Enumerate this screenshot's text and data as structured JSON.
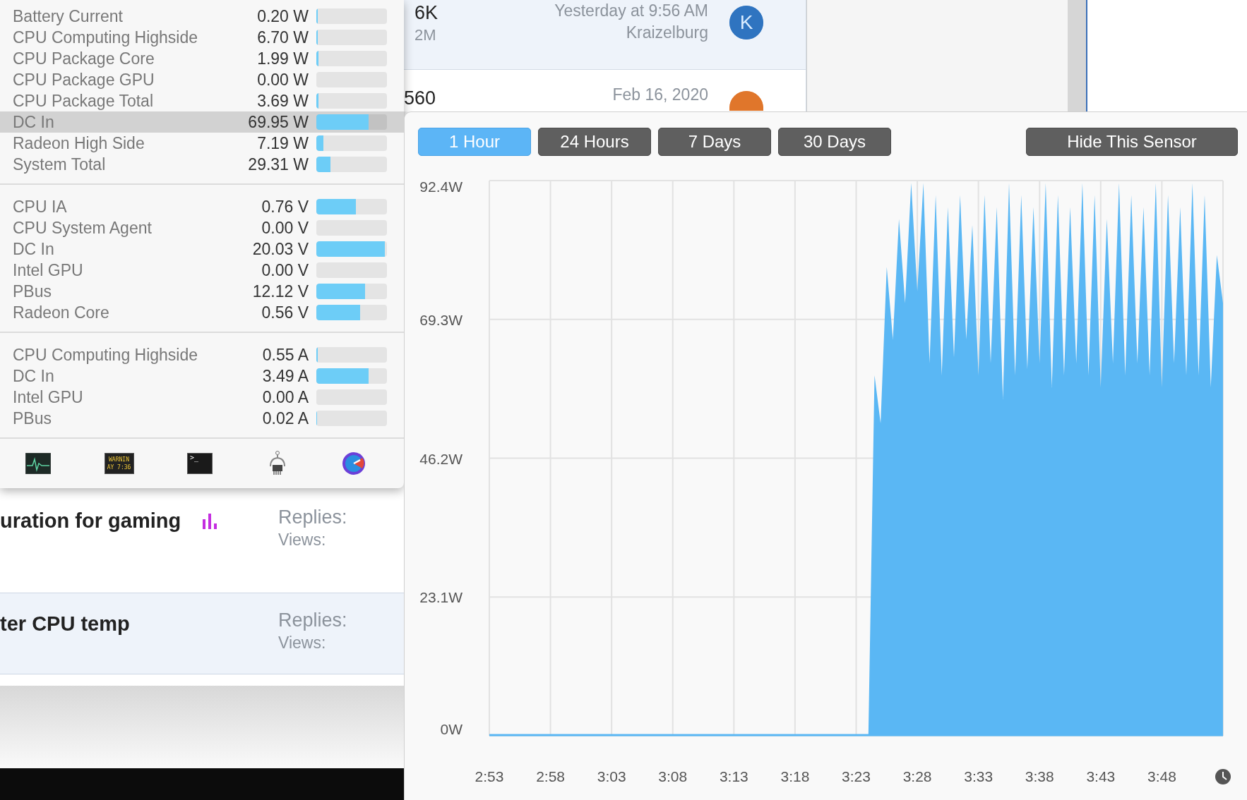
{
  "sensor_panel": {
    "sections": [
      {
        "rows": [
          {
            "label": "Battery Current",
            "reading": "0.20 W",
            "level": 0.02,
            "selected": false
          },
          {
            "label": "CPU Computing Highside",
            "reading": "6.70 W",
            "level": 0.02,
            "selected": false
          },
          {
            "label": "CPU Package Core",
            "reading": "1.99 W",
            "level": 0.03,
            "selected": false
          },
          {
            "label": "CPU Package GPU",
            "reading": "0.00 W",
            "level": 0,
            "selected": false
          },
          {
            "label": "CPU Package Total",
            "reading": "3.69 W",
            "level": 0.03,
            "selected": false
          },
          {
            "label": "DC In",
            "reading": "69.95 W",
            "level": 0.74,
            "selected": true
          },
          {
            "label": "Radeon High Side",
            "reading": "7.19 W",
            "level": 0.1,
            "selected": false
          },
          {
            "label": "System Total",
            "reading": "29.31 W",
            "level": 0.2,
            "selected": false
          }
        ]
      },
      {
        "rows": [
          {
            "label": "CPU IA",
            "reading": "0.76 V",
            "level": 0.56,
            "selected": false
          },
          {
            "label": "CPU System Agent",
            "reading": "0.00 V",
            "level": 0,
            "selected": false
          },
          {
            "label": "DC In",
            "reading": "20.03 V",
            "level": 0.97,
            "selected": false
          },
          {
            "label": "Intel GPU",
            "reading": "0.00 V",
            "level": 0,
            "selected": false
          },
          {
            "label": "PBus",
            "reading": "12.12 V",
            "level": 0.69,
            "selected": false
          },
          {
            "label": "Radeon Core",
            "reading": "0.56 V",
            "level": 0.62,
            "selected": false
          }
        ]
      },
      {
        "rows": [
          {
            "label": "CPU Computing Highside",
            "reading": "0.55 A",
            "level": 0.02,
            "selected": false
          },
          {
            "label": "DC In",
            "reading": "3.49 A",
            "level": 0.74,
            "selected": false
          },
          {
            "label": "Intel GPU",
            "reading": "0.00 A",
            "level": 0,
            "selected": false
          },
          {
            "label": "PBus",
            "reading": "0.02 A",
            "level": 0.01,
            "selected": false
          }
        ]
      }
    ]
  },
  "toolbar_icons": [
    {
      "kind": "activity"
    },
    {
      "kind": "console",
      "lines": [
        "WARNIN",
        "AY 7:36"
      ]
    },
    {
      "kind": "terminal",
      "prompt": ">_"
    },
    {
      "kind": "system-info"
    },
    {
      "kind": "gauge"
    }
  ],
  "thread_stats": [
    {
      "stat_1": "6K",
      "stat_2": "2M",
      "last_post_time": "Yesterday at 9:56 AM",
      "last_poster": "Kraizelburg",
      "avatar_letter": "K",
      "color": "#2f74c0",
      "highlighted": true
    },
    {
      "stat_1": "560",
      "last_post_time": "Feb 16, 2020",
      "color": "#e0762b",
      "highlighted": false
    }
  ],
  "threads": [
    {
      "title": "uration for gaming",
      "poll": true,
      "replies_label": "Replies:",
      "views_label": "Views:",
      "highlighted": false
    },
    {
      "title": "ter CPU temp",
      "poll": false,
      "replies_label": "Replies:",
      "views_label": "Views:",
      "highlighted": true
    }
  ],
  "history": {
    "ranges": [
      {
        "label": "1 Hour",
        "selected": true
      },
      {
        "label": "24 Hours",
        "selected": false
      },
      {
        "label": "7 Days",
        "selected": false
      },
      {
        "label": "30 Days",
        "selected": false
      }
    ],
    "hide_button": "Hide This Sensor",
    "chart_data": {
      "type": "area",
      "grid": true,
      "ylim": [
        0,
        92.4
      ],
      "yticks": [
        {
          "value": 0,
          "label": "0W"
        },
        {
          "value": 23.1,
          "label": "23.1W"
        },
        {
          "value": 46.2,
          "label": "46.2W"
        },
        {
          "value": 69.3,
          "label": "69.3W"
        },
        {
          "value": 92.4,
          "label": "92.4W"
        }
      ],
      "categories": [
        "2:53",
        null,
        null,
        null,
        null,
        null,
        null,
        null,
        null,
        null,
        "2:58",
        null,
        null,
        null,
        null,
        null,
        null,
        null,
        null,
        null,
        "3:03",
        null,
        null,
        null,
        null,
        null,
        null,
        null,
        null,
        null,
        "3:08",
        null,
        null,
        null,
        null,
        null,
        null,
        null,
        null,
        null,
        "3:13",
        null,
        null,
        null,
        null,
        null,
        null,
        null,
        null,
        null,
        "3:18",
        null,
        null,
        null,
        null,
        null,
        null,
        null,
        null,
        null,
        "3:23",
        null,
        null,
        null,
        null,
        null,
        null,
        null,
        null,
        null,
        "3:28",
        null,
        null,
        null,
        null,
        null,
        null,
        null,
        null,
        null,
        "3:33",
        null,
        null,
        null,
        null,
        null,
        null,
        null,
        null,
        null,
        "3:38",
        null,
        null,
        null,
        null,
        null,
        null,
        null,
        null,
        null,
        "3:43",
        null,
        null,
        null,
        null,
        null,
        null,
        null,
        null,
        null,
        "3:48",
        null,
        null,
        null,
        null,
        null,
        null,
        null,
        null,
        null,
        null
      ],
      "series": [
        {
          "color": "#5ab7f4",
          "values": [
            0,
            0,
            0,
            0,
            0,
            0,
            0,
            0,
            0,
            0,
            0,
            0,
            0,
            0,
            0,
            0,
            0,
            0,
            0,
            0,
            0,
            0,
            0,
            0,
            0,
            0,
            0,
            0,
            0,
            0,
            0,
            0,
            0,
            0,
            0,
            0,
            0,
            0,
            0,
            0,
            0,
            0,
            0,
            0,
            0,
            0,
            0,
            0,
            0,
            0,
            0,
            0,
            0,
            0,
            0,
            0,
            0,
            0,
            0,
            0,
            0,
            0,
            0,
            60,
            52,
            78,
            66,
            86,
            72,
            92,
            74,
            92,
            62,
            90,
            60,
            88,
            63,
            90,
            66,
            85,
            60,
            90,
            62,
            88,
            56,
            92,
            60,
            90,
            61,
            88,
            62,
            92,
            58,
            90,
            60,
            88,
            62,
            92,
            60,
            90,
            58,
            86,
            62,
            92,
            60,
            90,
            62,
            88,
            60,
            92,
            58,
            90,
            62,
            88,
            60,
            92,
            60,
            90,
            58,
            80,
            72
          ]
        }
      ]
    }
  }
}
